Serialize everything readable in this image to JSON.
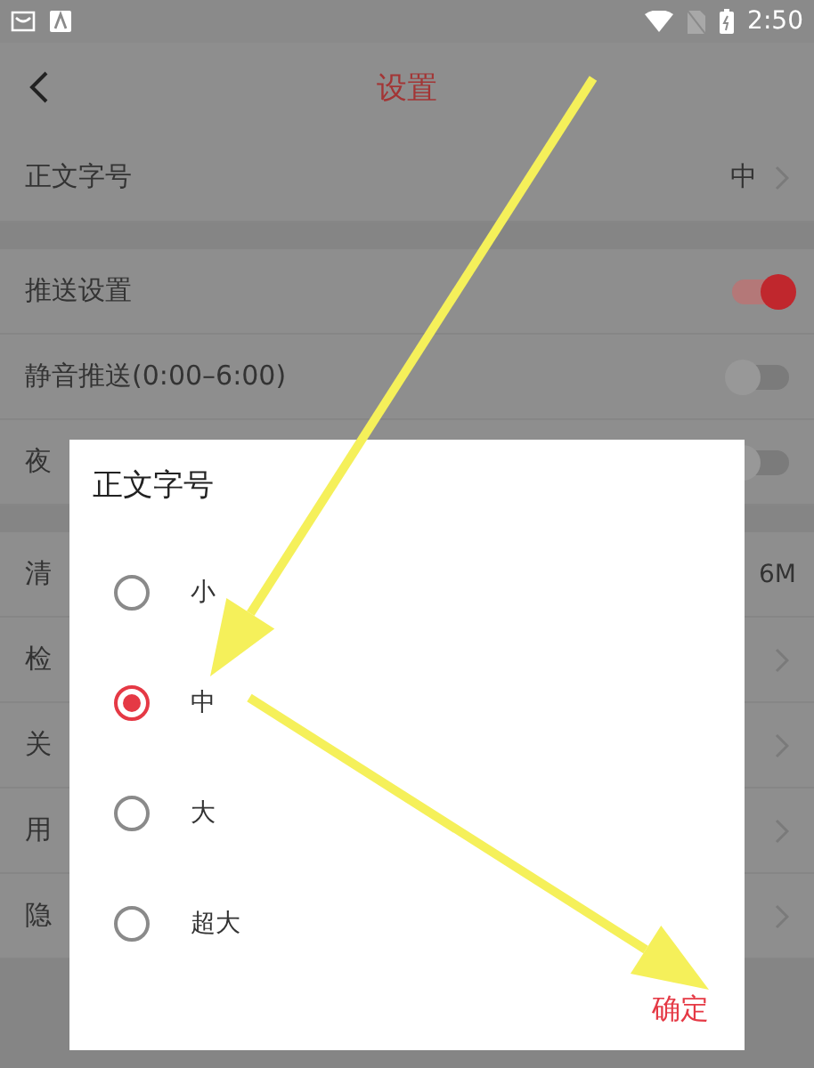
{
  "status_bar": {
    "time": "2:50"
  },
  "header": {
    "title": "设置"
  },
  "sections": [
    [
      {
        "kind": "choice",
        "label": "正文字号",
        "value": "中"
      }
    ],
    [
      {
        "kind": "toggle",
        "label": "推送设置",
        "on": true
      },
      {
        "kind": "toggle",
        "label": "静音推送(0:00–6:00)",
        "on": false
      },
      {
        "kind": "toggle",
        "label": "夜",
        "on": false
      }
    ],
    [
      {
        "kind": "info",
        "label": "清",
        "value": "6M"
      },
      {
        "kind": "link",
        "label": "检"
      },
      {
        "kind": "link",
        "label": "关"
      },
      {
        "kind": "link",
        "label": "用"
      },
      {
        "kind": "link",
        "label": "隐"
      }
    ]
  ],
  "dialog": {
    "title": "正文字号",
    "options": [
      {
        "label": "小",
        "selected": false
      },
      {
        "label": "中",
        "selected": true
      },
      {
        "label": "大",
        "selected": false
      },
      {
        "label": "超大",
        "selected": false
      }
    ],
    "confirm": "确定"
  }
}
